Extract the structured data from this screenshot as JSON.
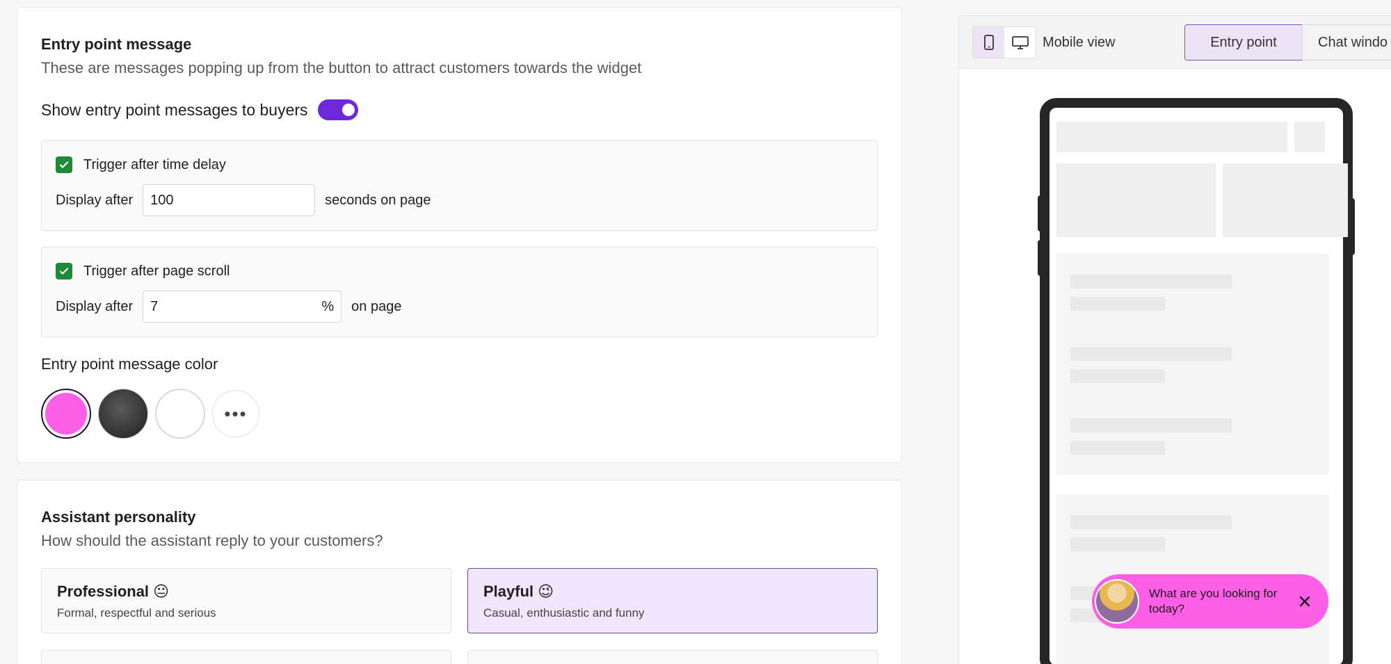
{
  "entry_point": {
    "title": "Entry point message",
    "subtitle": "These are messages popping up from the button to attract customers towards the widget",
    "toggle_label": "Show entry point messages to buyers",
    "toggle_on": true,
    "time_trigger": {
      "label": "Trigger after time delay",
      "checked": true,
      "prefix": "Display after",
      "value": "100",
      "suffix": "seconds on page"
    },
    "scroll_trigger": {
      "label": "Trigger after page scroll",
      "checked": true,
      "prefix": "Display after",
      "value": "7",
      "unit": "%",
      "suffix": "on page"
    },
    "color_label": "Entry point message color",
    "colors": [
      "#ff5ee6",
      "#2b2b2b",
      "#ffffff"
    ],
    "selected_color": "#ff5ee6",
    "more_label": "•••"
  },
  "personality": {
    "title": "Assistant personality",
    "subtitle": "How should the assistant reply to your customers?",
    "options": [
      {
        "name": "Professional",
        "emoji": "😐",
        "desc": "Formal, respectful and serious"
      },
      {
        "name": "Playful",
        "emoji": "😉",
        "desc": "Casual, enthusiastic and funny"
      }
    ],
    "selected": "Playful"
  },
  "preview": {
    "view_label": "Mobile view",
    "tabs": [
      "Entry point",
      "Chat windo"
    ],
    "active_tab": "Entry point",
    "bubble_text": "What are you looking for today?",
    "accent": "#6d28d9"
  }
}
